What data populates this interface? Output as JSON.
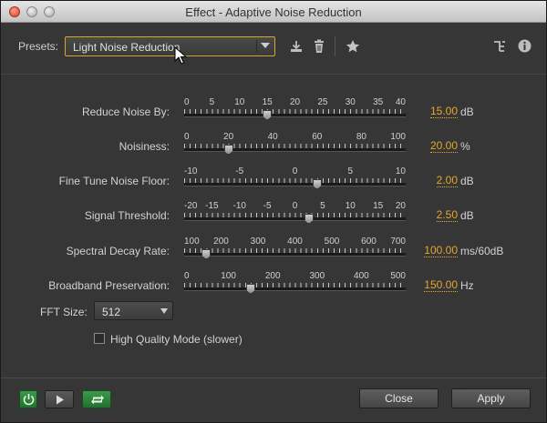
{
  "window": {
    "title": "Effect - Adaptive Noise Reduction"
  },
  "presets": {
    "label": "Presets:",
    "selected": "Light Noise Reduction",
    "icons": [
      "save-preset-icon",
      "delete-preset-icon",
      "favorite-star-icon",
      "routing-icon",
      "info-icon"
    ]
  },
  "params": [
    {
      "label": "Reduce Noise By:",
      "scale": [
        "0",
        "5",
        "10",
        "15",
        "20",
        "25",
        "30",
        "35",
        "40"
      ],
      "value": "15.00",
      "unit": "dB",
      "fraction": 0.375
    },
    {
      "label": "Noisiness:",
      "scale": [
        "0",
        "20",
        "40",
        "60",
        "80",
        "100"
      ],
      "value": "20.00",
      "unit": "%",
      "fraction": 0.2
    },
    {
      "label": "Fine Tune Noise Floor:",
      "scale": [
        "-10",
        "-5",
        "0",
        "5",
        "10"
      ],
      "value": "2.00",
      "unit": "dB",
      "fraction": 0.6
    },
    {
      "label": "Signal Threshold:",
      "scale": [
        "-20",
        "-15",
        "-10",
        "-5",
        "0",
        "5",
        "10",
        "15",
        "20"
      ],
      "value": "2.50",
      "unit": "dB",
      "fraction": 0.5625
    },
    {
      "label": "Spectral Decay Rate:",
      "scale": [
        "100",
        "200",
        "300",
        "400",
        "500",
        "600",
        "700"
      ],
      "value": "100.00",
      "unit": "ms/60dB",
      "fraction": 0.1
    },
    {
      "label": "Broadband Preservation:",
      "scale": [
        "0",
        "100",
        "200",
        "300",
        "400",
        "500"
      ],
      "value": "150.00",
      "unit": "Hz",
      "fraction": 0.3
    }
  ],
  "fft": {
    "label": "FFT Size:",
    "selected": "512"
  },
  "high_quality": {
    "label": "High Quality Mode (slower)",
    "checked": false
  },
  "buttons": {
    "close": "Close",
    "apply": "Apply"
  },
  "colors": {
    "accent": "#e3a72c",
    "power_green": "#3a9b48"
  }
}
